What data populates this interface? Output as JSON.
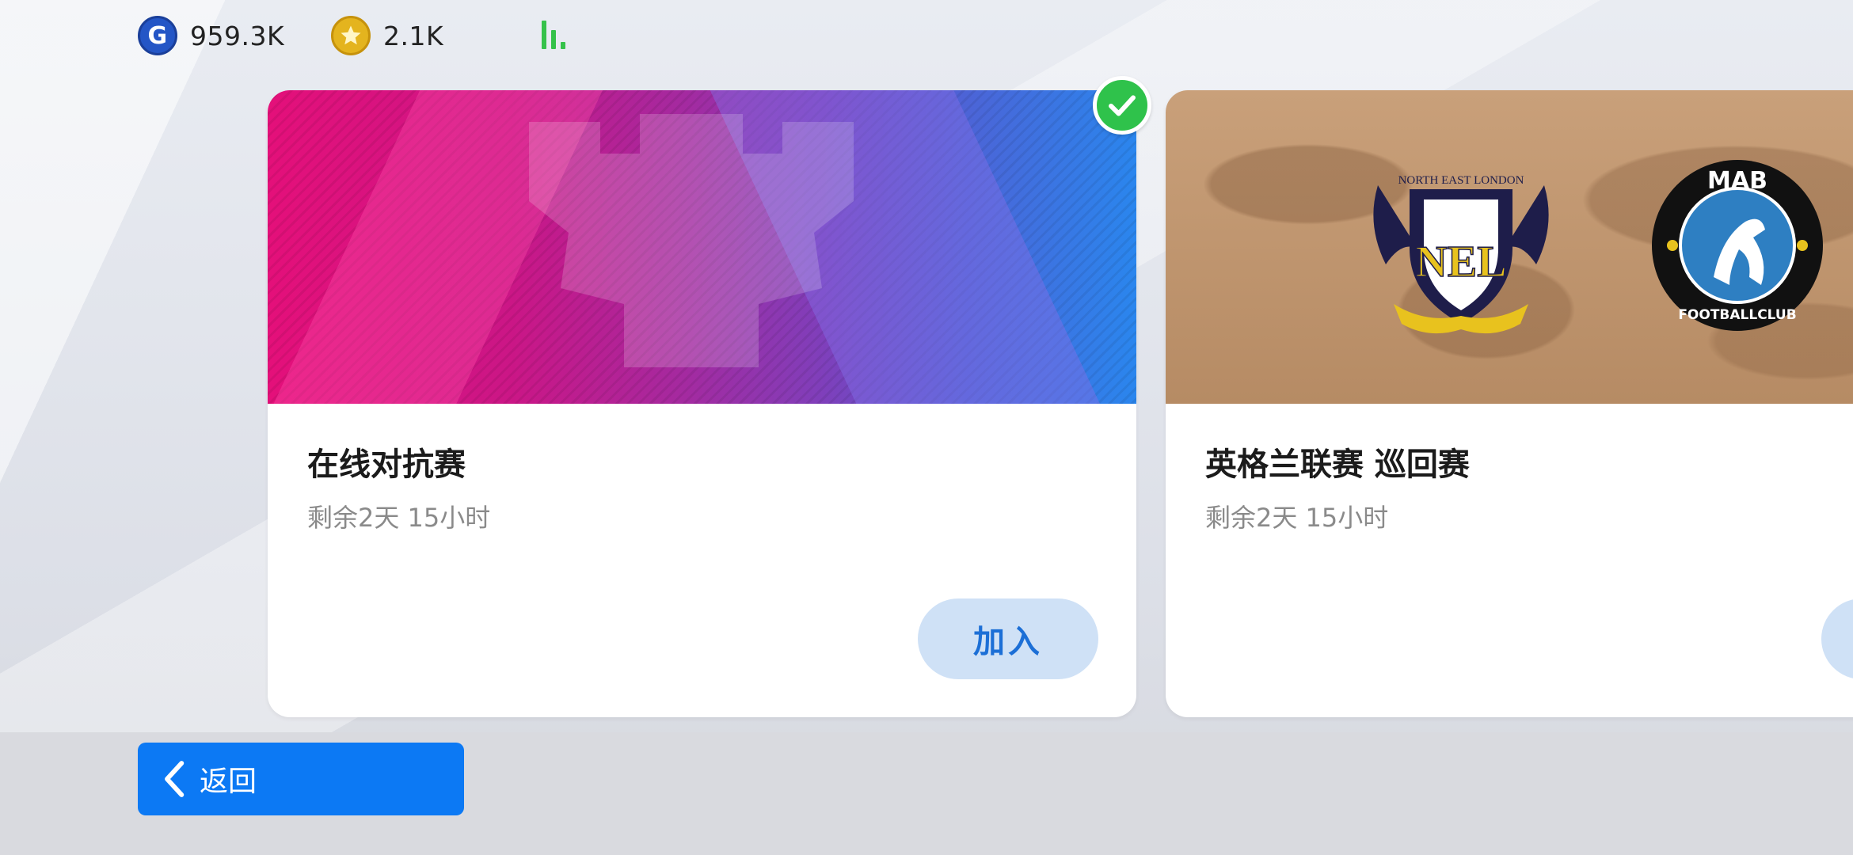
{
  "header": {
    "gp_value": "959.3K",
    "coins_value": "2.1K",
    "gp_icon_letter": "G"
  },
  "cards": [
    {
      "title": "在线对抗赛",
      "time_left": "剩余2天 15小时",
      "join_label": "加入",
      "selected": true
    },
    {
      "title": "英格兰联赛 巡回赛",
      "time_left": "剩余2天 15小时",
      "crest_1_text": "NORTH EAST LONDON",
      "crest_1_letters": "NEL",
      "crest_2_top": "MAB",
      "crest_2_bottom": "FOOTBALLCLUB"
    }
  ],
  "footer": {
    "back_label": "返回"
  },
  "colors": {
    "accent_blue": "#0c79f4",
    "join_bg": "#cfe1f6",
    "join_text": "#1c6fd6",
    "check_green": "#2fc24b",
    "signal_green": "#35c24a"
  }
}
